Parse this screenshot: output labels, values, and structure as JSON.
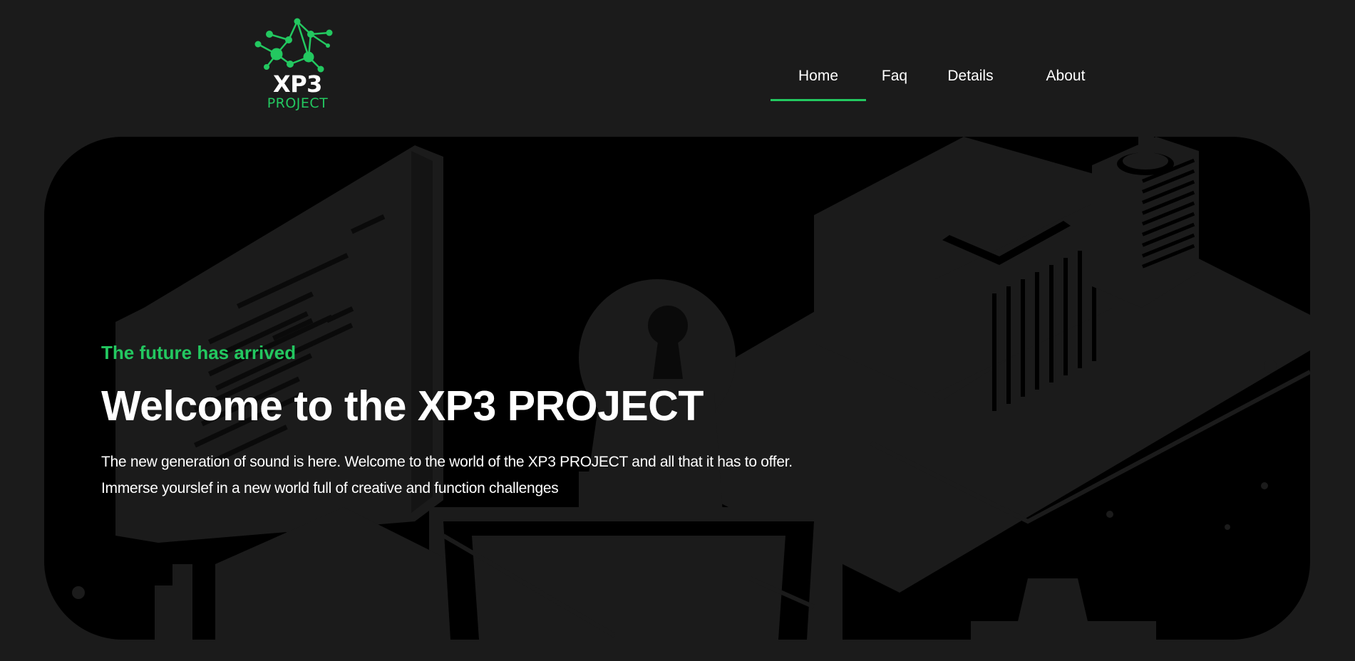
{
  "header": {
    "logo": {
      "title": "XP3",
      "subtitle": "PROJECT",
      "icon": "network-nodes-icon"
    },
    "nav": [
      {
        "label": "Home",
        "active": true
      },
      {
        "label": "Faq",
        "active": false
      },
      {
        "label": "Details",
        "active": false
      },
      {
        "label": "About",
        "active": false
      }
    ]
  },
  "hero": {
    "eyebrow": "The future has arrived",
    "title": "Welcome to the XP3 PROJECT",
    "description_line1": "The new generation of sound is here. Welcome to the world of the XP3 PROJECT and all that it has to offer.",
    "description_line2": "Immerse yourslef in a new world full of creative and function challenges",
    "background_illustration": "isometric-city-illustration"
  },
  "colors": {
    "accent": "#23c860",
    "page_background": "#1b1b1b",
    "hero_background": "#000000",
    "illustration": "#1b1b1b",
    "text": "#ffffff"
  }
}
